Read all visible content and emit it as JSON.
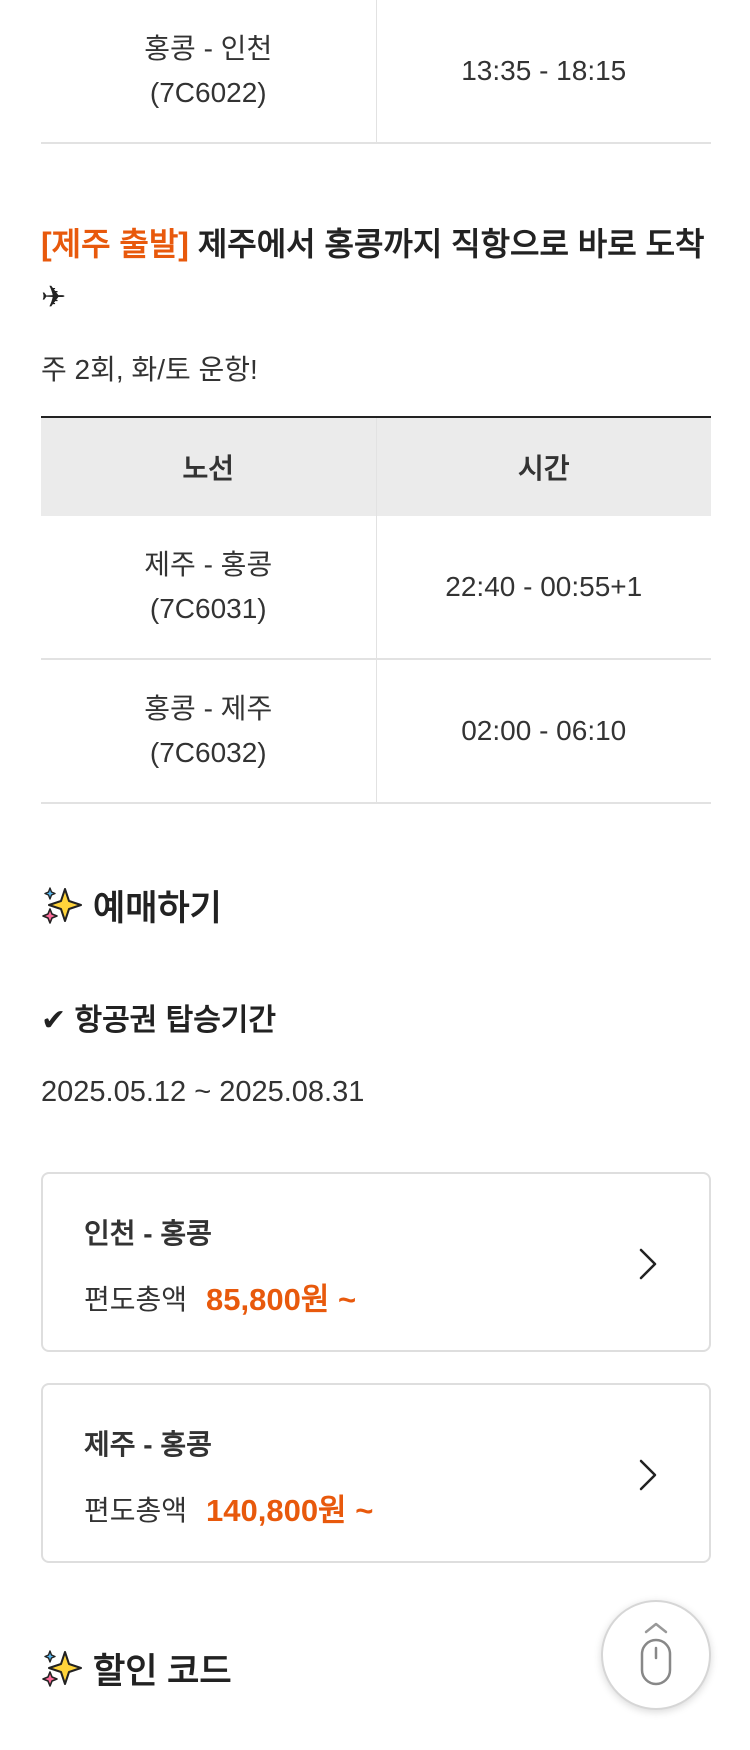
{
  "top_table": {
    "rows": [
      {
        "route": "홍콩 - 인천",
        "flight": "(7C6022)",
        "time": "13:35 - 18:15"
      }
    ]
  },
  "jeju_section": {
    "tag": "[제주 출발]",
    "title": " 제주에서 홍콩까지 직항으로 바로 도착",
    "plane_symbol": "✈",
    "schedule_note": "주 2회, 화/토 운항!",
    "headers": [
      "노선",
      "시간"
    ],
    "rows": [
      {
        "route": "제주 - 홍콩",
        "flight": "(7C6031)",
        "time": "22:40 - 00:55+1"
      },
      {
        "route": "홍콩 - 제주",
        "flight": "(7C6032)",
        "time": "02:00 - 06:10"
      }
    ]
  },
  "booking": {
    "heading": "예매하기",
    "period_label": "✔ 항공권 탑승기간",
    "period": "2025.05.12 ~ 2025.08.31",
    "cards": [
      {
        "route": "인천 - 홍콩",
        "fare_label": "편도총액",
        "price": "85,800원 ~"
      },
      {
        "route": "제주 - 홍콩",
        "fare_label": "편도총액",
        "price": "140,800원 ~"
      }
    ]
  },
  "discount": {
    "heading": "할인 코드"
  },
  "icons": {
    "sparkle": "sparkle-icon",
    "chevron": "chevron-right-icon",
    "scroll": "mouse-scroll-icon"
  },
  "colors": {
    "accent": "#e8590c",
    "sparkle_yellow": "#ffd43b",
    "sparkle_pink": "#ff6b9a",
    "sparkle_blue": "#5ab8f0"
  }
}
